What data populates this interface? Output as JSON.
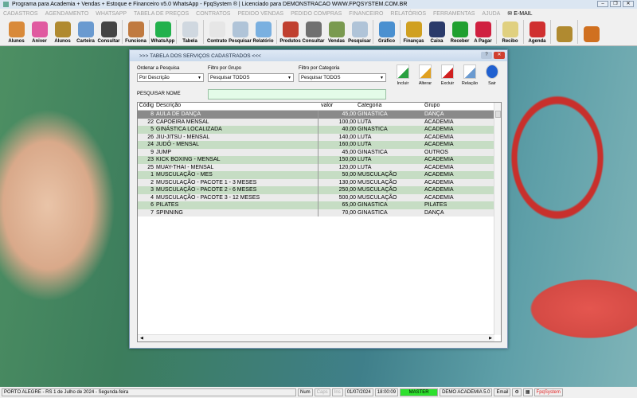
{
  "window_title": "Programa para Academia + Vendas + Estoque e Financeiro v5.0 WhatsApp - FpqSystem ® | Licenciado para  DEMONSTRACAO WWW.FPQSYSTEM.COM.BR",
  "menu": [
    "CADASTROS",
    "AGENDAMENTO",
    "WHATSAPP",
    "TABELA DE PREÇOS",
    "CONTRATOS",
    "PEDIDO VENDAS",
    "PEDIDO COMPRAS",
    "FINANCEIRO",
    "RELATÓRIOS",
    "FERRAMENTAS",
    "AJUDA"
  ],
  "menu_email": "E-MAIL",
  "toolbar": [
    {
      "label": "Alunos",
      "icon": "students-icon",
      "color": "#d98a3a"
    },
    {
      "label": "Aniver",
      "icon": "cake-icon",
      "color": "#e05aa0"
    },
    {
      "label": "Alunos",
      "icon": "coins-icon",
      "color": "#b08a30"
    },
    {
      "label": "Carteira",
      "icon": "id-card-icon",
      "color": "#6a9ad0"
    },
    {
      "label": "Consultar",
      "icon": "id-search-icon",
      "color": "#444"
    },
    {
      "sep": true
    },
    {
      "label": "Funciona",
      "icon": "employee-icon",
      "color": "#c07a40"
    },
    {
      "sep": true
    },
    {
      "label": "WhatsApp",
      "icon": "whatsapp-icon",
      "color": "#22b14c"
    },
    {
      "sep": true
    },
    {
      "label": "Tabela",
      "icon": "table-icon",
      "color": "#d0d8e0"
    },
    {
      "sep": true
    },
    {
      "label": "Contrato",
      "icon": "contract-icon",
      "color": "#e6e6e6"
    },
    {
      "label": "Pesquisar",
      "icon": "search-docs-icon",
      "color": "#b0c4d8"
    },
    {
      "label": "Relatório",
      "icon": "printer-icon",
      "color": "#7ab0e0"
    },
    {
      "sep": true
    },
    {
      "label": "Produtos",
      "icon": "products-icon",
      "color": "#c04030"
    },
    {
      "label": "Consultar",
      "icon": "barcode-icon",
      "color": "#707070"
    },
    {
      "label": "Vendas",
      "icon": "cart-icon",
      "color": "#7a9a50"
    },
    {
      "label": "Pesquisar",
      "icon": "search-docs-icon",
      "color": "#b0c4d8"
    },
    {
      "sep": true
    },
    {
      "label": "Gráfico",
      "icon": "chart-icon",
      "color": "#4a90d0"
    },
    {
      "sep": true
    },
    {
      "label": "Finanças",
      "icon": "finance-icon",
      "color": "#d0a020"
    },
    {
      "label": "Caixa",
      "icon": "cashbook-icon",
      "color": "#2a3a6a"
    },
    {
      "label": "Receber",
      "icon": "receive-icon",
      "color": "#20a030"
    },
    {
      "label": "A Pagar",
      "icon": "pay-icon",
      "color": "#d02040"
    },
    {
      "sep": true
    },
    {
      "label": "Recibo",
      "icon": "receipt-icon",
      "color": "#e0d080"
    },
    {
      "sep": true
    },
    {
      "label": "Agenda",
      "icon": "calendar-icon",
      "color": "#d03030"
    },
    {
      "sep": true
    },
    {
      "label": "",
      "icon": "coins-icon",
      "color": "#b08a30"
    },
    {
      "sep": true
    },
    {
      "label": "",
      "icon": "exit-door-icon",
      "color": "#d07020"
    }
  ],
  "dialog": {
    "title": ">>>  TABELA DOS SERVIÇOS CADASTRADOS  <<<",
    "order_label": "Ordenar a Pesquisa",
    "order_value": "Por Descrição",
    "group_label": "Filtro por Grupo",
    "group_value": "Pesquisar TODOS",
    "category_label": "Filtro por Categoria",
    "category_value": "Pesquisar TODOS",
    "search_label": "PESQUISAR NOME",
    "search_value": "",
    "actions": [
      {
        "label": "Incluir",
        "icon": "add-document-icon",
        "color": "#2aa040"
      },
      {
        "label": "Alterar",
        "icon": "edit-document-icon",
        "color": "#e0a020"
      },
      {
        "label": "Excluir",
        "icon": "delete-document-icon",
        "color": "#d02020"
      },
      {
        "label": "Relação",
        "icon": "print-list-icon",
        "color": "#6a9ad0"
      },
      {
        "label": "Sair",
        "icon": "exit-arrow-icon",
        "color": "#2060d0"
      }
    ],
    "columns": [
      "Códig",
      "Descrição",
      "valor",
      "Categoria",
      "Grupo"
    ],
    "rows": [
      [
        "8",
        "AULA DE DANÇA",
        "45,00",
        "GINASTICA",
        "DANÇA"
      ],
      [
        "22",
        "CAPOEIRA MENSAL",
        "100,00",
        "LUTA",
        "ACADEMIA"
      ],
      [
        "5",
        "GINÁSTICA LOCALIZADA",
        "40,00",
        "GINASTICA",
        "ACADEMIA"
      ],
      [
        "26",
        "JIU-JITSU - MENSAL",
        "140,00",
        "LUTA",
        "ACADEMIA"
      ],
      [
        "24",
        "JUDÔ - MENSAL",
        "160,00",
        "LUTA",
        "ACADEMIA"
      ],
      [
        "9",
        "JUMP",
        "45,00",
        "GINASTICA",
        "OUTROS"
      ],
      [
        "23",
        "KICK BOXING - MENSAL",
        "150,00",
        "LUTA",
        "ACADEMIA"
      ],
      [
        "25",
        "MUAY-THAI - MENSAL",
        "120,00",
        "LUTA",
        "ACADEMIA"
      ],
      [
        "1",
        "MUSCULAÇÃO - MES",
        "50,00",
        "MUSCULAÇÃO",
        "ACADEMIA"
      ],
      [
        "2",
        "MUSCULAÇÃO - PACOTE 1 - 3 MESES",
        "130,00",
        "MUSCULAÇÃO",
        "ACADEMIA"
      ],
      [
        "3",
        "MUSCULAÇÃO - PACOTE 2 - 6 MESES",
        "250,00",
        "MUSCULAÇÃO",
        "ACADEMIA"
      ],
      [
        "4",
        "MUSCULAÇÃO - PACOTE 3 - 12 MESES",
        "500,00",
        "MUSCULAÇÃO",
        "ACADEMIA"
      ],
      [
        "6",
        "PILATES",
        "65,00",
        "GINASTICA",
        "PILATES"
      ],
      [
        "7",
        "SPINNING",
        "70,00",
        "GINASTICA",
        "DANÇA"
      ]
    ]
  },
  "status": {
    "location": "PORTO ALEGRE - RS  1 de Julho de 2024 - Segunda-feira",
    "num": "Num",
    "caps": "Caps",
    "ins": "Ins",
    "date": "01/07/2024",
    "time": "18:00:09",
    "user": "MASTER",
    "company": "DEMO ACADEMIA 5.0",
    "email": "Email",
    "brand": "FpqSystem"
  }
}
